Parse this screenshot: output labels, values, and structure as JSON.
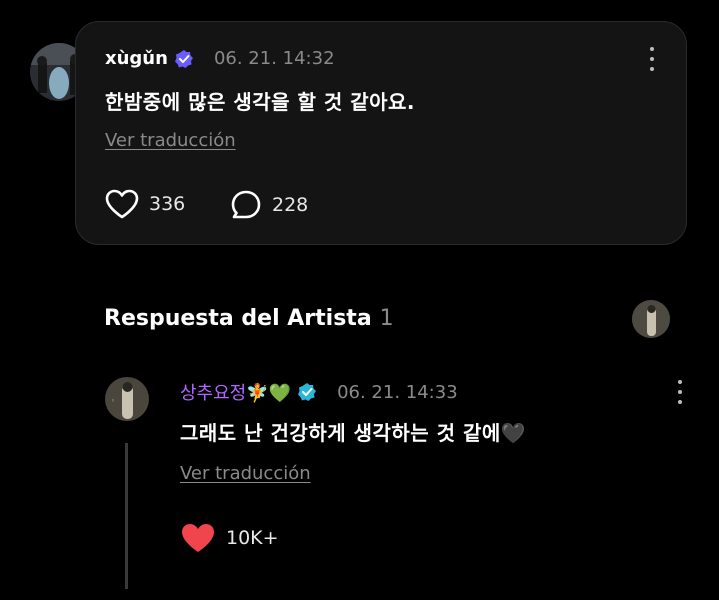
{
  "post": {
    "username": "xùgǔn",
    "timestamp": "06. 21. 14:32",
    "body": "한밤중에 많은 생각을 할 것 같아요.",
    "translate_label": "Ver traducción",
    "likes": "336",
    "comments": "228"
  },
  "artist_reply_section": {
    "title": "Respuesta del Artista",
    "count": "1"
  },
  "reply": {
    "username": "상추요정🧚💚",
    "timestamp": "06. 21. 14:33",
    "body": "그래도 난 건강하게 생각하는 것 같에🖤",
    "translate_label": "Ver traducción",
    "likes": "10K+"
  },
  "colors": {
    "card_bg": "#141414",
    "verified_purple": "#5b4bff",
    "verified_cyan": "#29b6d8",
    "heart_red": "#f0454c",
    "reply_name": "#b266ff"
  }
}
